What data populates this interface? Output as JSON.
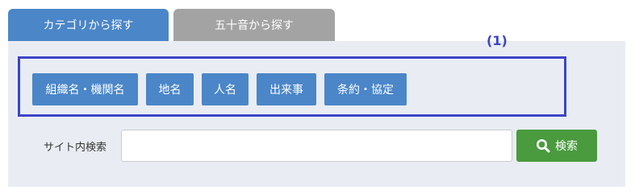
{
  "tabs": [
    {
      "label": "カテゴリから探す"
    },
    {
      "label": "五十音から探す"
    }
  ],
  "annotation": {
    "label": "(1)"
  },
  "categories": [
    {
      "label": "組織名・機関名"
    },
    {
      "label": "地名"
    },
    {
      "label": "人名"
    },
    {
      "label": "出来事"
    },
    {
      "label": "条約・協定"
    }
  ],
  "search": {
    "label": "サイト内検索",
    "value": "",
    "button_label": "検索",
    "button_icon": "search-icon"
  },
  "colors": {
    "accent_blue": "#4a86c8",
    "inactive_tab": "#a3a3a3",
    "search_green": "#4a9a3e",
    "annotation": "#3c45c8",
    "panel_bg": "#e9edf3"
  }
}
